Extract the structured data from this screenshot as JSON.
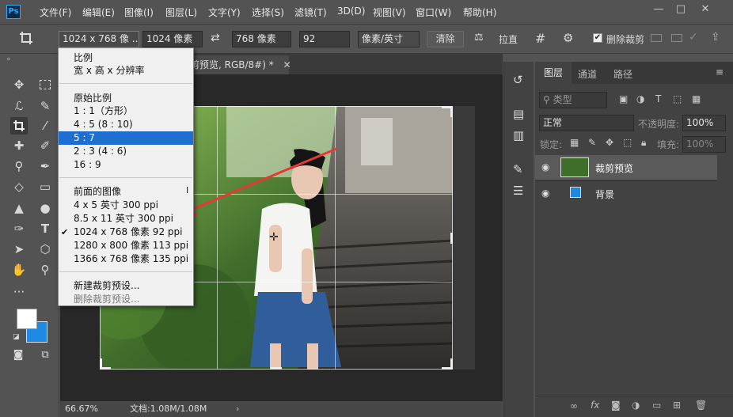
{
  "app": {
    "logo": "Ps"
  },
  "menu": [
    "文件(F)",
    "编辑(E)",
    "图像(I)",
    "图层(L)",
    "文字(Y)",
    "选择(S)",
    "滤镜(T)",
    "3D(D)",
    "视图(V)",
    "窗口(W)",
    "帮助(H)"
  ],
  "window_controls": [
    "—",
    "□",
    "✕"
  ],
  "options": {
    "preset": "1024 x 768 像 ...",
    "width": "1024 像素",
    "height": "768 像素",
    "resolution": "92",
    "unit": "像素/英寸",
    "clear": "清除",
    "straighten": "拉直",
    "delete_cropped": "删除裁剪"
  },
  "document": {
    "tab_title": "剪预览, RGB/8#) *"
  },
  "status": {
    "zoom": "66.67%",
    "doc_info": "文档:1.08M/1.08M"
  },
  "dropdown": {
    "items": [
      {
        "label": "比例",
        "type": "head"
      },
      {
        "label": "宽 x 高 x 分辨率",
        "type": "item"
      },
      {
        "label": "原始比例",
        "type": "head"
      },
      {
        "label": "1 : 1（方形）",
        "type": "item"
      },
      {
        "label": "4 : 5 (8 : 10)",
        "type": "item"
      },
      {
        "label": "5 : 7",
        "type": "selected"
      },
      {
        "label": "2 : 3 (4 : 6)",
        "type": "item"
      },
      {
        "label": "16 : 9",
        "type": "item"
      },
      {
        "label": "前面的图像",
        "type": "head"
      },
      {
        "label": "4 x 5 英寸 300 ppi",
        "type": "item"
      },
      {
        "label": "8.5 x 11 英寸 300 ppi",
        "type": "item"
      },
      {
        "label": "1024 x 768 像素 92 ppi",
        "type": "checked"
      },
      {
        "label": "1280 x 800 像素 113 ppi",
        "type": "item"
      },
      {
        "label": "1366 x 768 像素 135 ppi",
        "type": "item"
      },
      {
        "label": "新建裁剪预设...",
        "type": "item"
      },
      {
        "label": "删除裁剪预设...",
        "type": "dim"
      }
    ],
    "check_mark": "✔"
  },
  "layers_panel": {
    "tabs": [
      "图层",
      "通道",
      "路径"
    ],
    "filter_label": "类型",
    "blend_mode": "正常",
    "opacity_label": "不透明度:",
    "opacity_value": "100%",
    "lock_label": "锁定:",
    "fill_label": "填充:",
    "fill_value": "100%",
    "layers": [
      {
        "name": "裁剪预览"
      },
      {
        "name": "背景"
      }
    ]
  },
  "colors": {
    "accent": "#1f6fd1",
    "arrow": "#e53935",
    "background_swatch": "#1e88e5"
  }
}
